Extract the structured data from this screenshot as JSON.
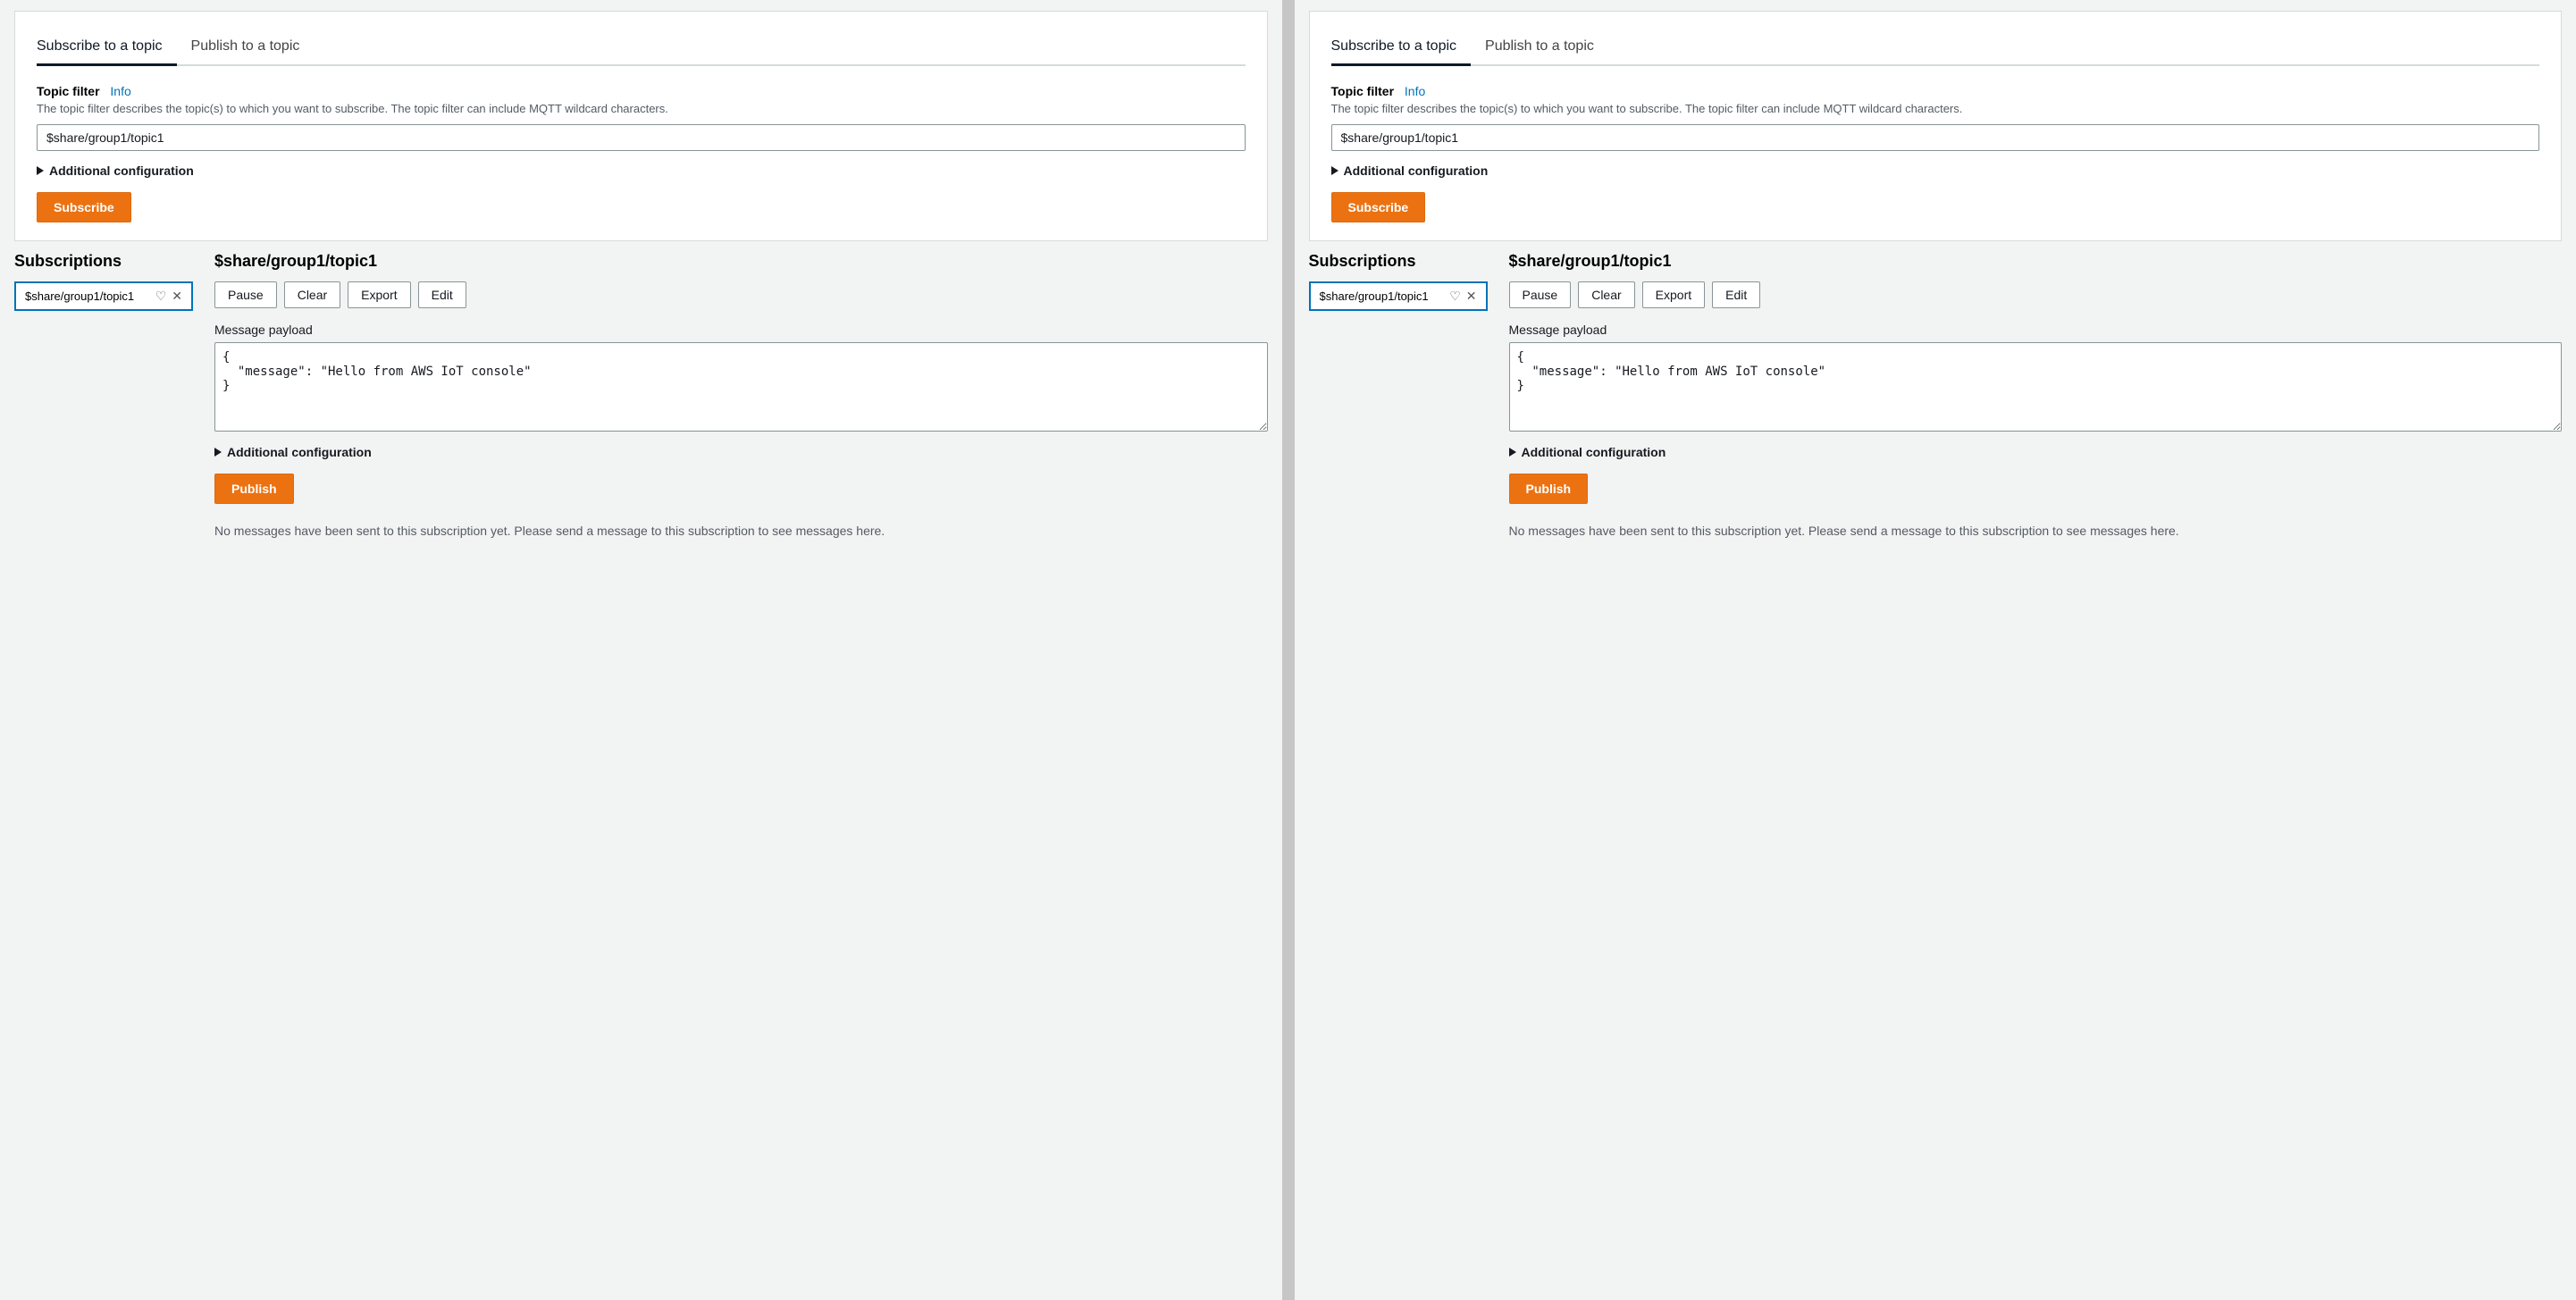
{
  "panels": [
    {
      "id": "left",
      "tabs": [
        {
          "id": "subscribe",
          "label": "Subscribe to a topic",
          "active": true
        },
        {
          "id": "publish",
          "label": "Publish to a topic",
          "active": false
        }
      ],
      "subscribe": {
        "field_label": "Topic filter",
        "info_label": "Info",
        "field_description": "The topic filter describes the topic(s) to which you want to subscribe. The topic filter can include MQTT wildcard characters.",
        "input_value": "$share/group1/topic1",
        "input_placeholder": "$share/group1/topic1",
        "additional_config_label": "Additional configuration",
        "subscribe_btn": "Subscribe"
      },
      "subscriptions": {
        "title": "Subscriptions",
        "items": [
          {
            "label": "$share/group1/topic1"
          }
        ]
      },
      "topic": {
        "title": "$share/group1/topic1",
        "actions": [
          "Pause",
          "Clear",
          "Export",
          "Edit"
        ],
        "payload_label": "Message payload",
        "payload_value": "{\n  \"message\": \"Hello from AWS IoT console\"\n}",
        "additional_config_label": "Additional configuration",
        "publish_btn": "Publish",
        "no_messages": "No messages have been sent to this subscription yet. Please send a message to this subscription to see messages here."
      }
    },
    {
      "id": "right",
      "tabs": [
        {
          "id": "subscribe",
          "label": "Subscribe to a topic",
          "active": true
        },
        {
          "id": "publish",
          "label": "Publish to a topic",
          "active": false
        }
      ],
      "subscribe": {
        "field_label": "Topic filter",
        "info_label": "Info",
        "field_description": "The topic filter describes the topic(s) to which you want to subscribe. The topic filter can include MQTT wildcard characters.",
        "input_value": "$share/group1/topic1",
        "input_placeholder": "$share/group1/topic1",
        "additional_config_label": "Additional configuration",
        "subscribe_btn": "Subscribe"
      },
      "subscriptions": {
        "title": "Subscriptions",
        "items": [
          {
            "label": "$share/group1/topic1"
          }
        ]
      },
      "topic": {
        "title": "$share/group1/topic1",
        "actions": [
          "Pause",
          "Clear",
          "Export",
          "Edit"
        ],
        "payload_label": "Message payload",
        "payload_value": "{\n  \"message\": \"Hello from AWS IoT console\"\n}",
        "additional_config_label": "Additional configuration",
        "publish_btn": "Publish",
        "no_messages": "No messages have been sent to this subscription yet. Please send a message to this subscription to see messages here."
      }
    }
  ]
}
